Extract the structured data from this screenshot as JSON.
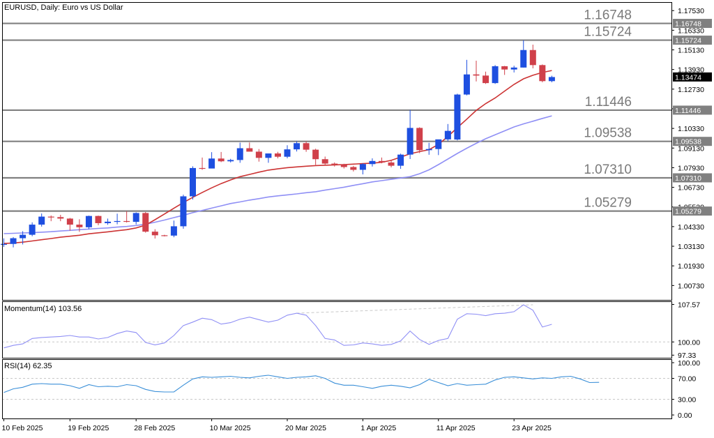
{
  "chart_data": {
    "type": "candlestick",
    "title": "EURUSD, Daily:  Euro vs US Dollar",
    "symbol": "EURUSD",
    "timeframe": "Daily",
    "description": "Euro vs US Dollar",
    "current_price": "1.13474",
    "price_axis": {
      "ticks": [
        "1.17530",
        "1.16330",
        "1.15130",
        "1.13930",
        "1.12730",
        "1.11530",
        "1.10330",
        "1.09130",
        "1.07930",
        "1.06730",
        "1.05530",
        "1.04330",
        "1.03130",
        "1.01930",
        "1.00730"
      ],
      "range": [
        0.9985,
        1.1805
      ]
    },
    "x_axis": {
      "labels": [
        {
          "text": "10 Feb 2025",
          "bar": 0
        },
        {
          "text": "19 Feb 2025",
          "bar": 7
        },
        {
          "text": "28 Feb 2025",
          "bar": 14
        },
        {
          "text": "10 Mar 2025",
          "bar": 22
        },
        {
          "text": "20 Mar 2025",
          "bar": 30
        },
        {
          "text": "1 Apr 2025",
          "bar": 38
        },
        {
          "text": "11 Apr 2025",
          "bar": 46
        },
        {
          "text": "23 Apr 2025",
          "bar": 54
        }
      ]
    },
    "horizontal_levels": [
      {
        "value": 1.16748,
        "label": "1.16748",
        "tag": "1.16748"
      },
      {
        "value": 1.15724,
        "label": "1.15724",
        "tag": "1.15724"
      },
      {
        "value": 1.11446,
        "label": "1.11446",
        "tag": "1.11446"
      },
      {
        "value": 1.09538,
        "label": "1.09538",
        "tag": "1.09538"
      },
      {
        "value": 1.0731,
        "label": "1.07310",
        "tag": "1.07310"
      },
      {
        "value": 1.05279,
        "label": "1.05279",
        "tag": "1.05279"
      }
    ],
    "candles": [
      [
        1.0326,
        1.0361,
        1.0309,
        1.0327
      ],
      [
        1.0327,
        1.0369,
        1.0306,
        1.0362
      ],
      [
        1.0362,
        1.0405,
        1.0324,
        1.0383
      ],
      [
        1.0383,
        1.0459,
        1.0374,
        1.0445
      ],
      [
        1.0445,
        1.0513,
        1.0433,
        1.0494
      ],
      [
        1.0494,
        1.0501,
        1.0466,
        1.0491
      ],
      [
        1.0491,
        1.0505,
        1.0466,
        1.0482
      ],
      [
        1.0482,
        1.0486,
        1.0408,
        1.0445
      ],
      [
        1.0445,
        1.0478,
        1.0401,
        1.0429
      ],
      [
        1.0429,
        1.05,
        1.0418,
        1.0498
      ],
      [
        1.0498,
        1.05,
        1.0441,
        1.0454
      ],
      [
        1.0454,
        1.0482,
        1.0444,
        1.0463
      ],
      [
        1.0463,
        1.0512,
        1.0447,
        1.0467
      ],
      [
        1.0467,
        1.0527,
        1.0458,
        1.0462
      ],
      [
        1.0462,
        1.052,
        1.0446,
        1.0516
      ],
      [
        1.0516,
        1.0522,
        1.0396,
        1.0402
      ],
      [
        1.0402,
        1.0417,
        1.036,
        1.038
      ],
      [
        1.038,
        1.0383,
        1.0373,
        1.0378
      ],
      [
        1.0378,
        1.047,
        1.0368,
        1.0435
      ],
      [
        1.0435,
        1.0628,
        1.042,
        1.0618
      ],
      [
        1.0618,
        1.0801,
        1.0599,
        1.0791
      ],
      [
        1.0791,
        1.0855,
        1.078,
        1.0788
      ],
      [
        1.0788,
        1.0888,
        1.0789,
        1.0849
      ],
      [
        1.0849,
        1.0889,
        1.0827,
        1.0832
      ],
      [
        1.0832,
        1.0847,
        1.0825,
        1.084
      ],
      [
        1.084,
        1.0946,
        1.0823,
        1.0912
      ],
      [
        1.0912,
        1.0947,
        1.0897,
        1.0891
      ],
      [
        1.0891,
        1.0907,
        1.083,
        1.0853
      ],
      [
        1.0853,
        1.088,
        1.0823,
        1.088
      ],
      [
        1.088,
        1.089,
        1.085,
        1.086
      ],
      [
        1.086,
        1.093,
        1.085,
        1.0905
      ],
      [
        1.0905,
        1.0955,
        1.0892,
        1.0943
      ],
      [
        1.0943,
        1.0954,
        1.089,
        1.0903
      ],
      [
        1.0903,
        1.0909,
        1.081,
        1.0845
      ],
      [
        1.0845,
        1.0861,
        1.081,
        1.0818
      ],
      [
        1.0818,
        1.0825,
        1.08,
        1.0813
      ],
      [
        1.0813,
        1.0817,
        1.0788,
        1.0797
      ],
      [
        1.0797,
        1.0804,
        1.077,
        1.078
      ],
      [
        1.078,
        1.082,
        1.0752,
        1.0815
      ],
      [
        1.0815,
        1.085,
        1.08,
        1.0834
      ],
      [
        1.0834,
        1.0855,
        1.082,
        1.0825
      ],
      [
        1.0825,
        1.0838,
        1.0795,
        1.0805
      ],
      [
        1.0805,
        1.0879,
        1.0786,
        1.0873
      ],
      [
        1.0873,
        1.1146,
        1.0846,
        1.1036
      ],
      [
        1.1036,
        1.104,
        1.0882,
        1.09
      ],
      [
        1.09,
        1.0945,
        1.0872,
        1.0907
      ],
      [
        1.0907,
        1.092,
        1.087,
        1.0966
      ],
      [
        1.0966,
        1.106,
        1.0955,
        1.1018
      ],
      [
        1.0965,
        1.1245,
        1.096,
        1.124
      ],
      [
        1.124,
        1.1452,
        1.1235,
        1.1363
      ],
      [
        1.1363,
        1.1447,
        1.132,
        1.1356
      ],
      [
        1.1356,
        1.138,
        1.1305,
        1.131
      ],
      [
        1.131,
        1.142,
        1.1305,
        1.1413
      ],
      [
        1.1413,
        1.1415,
        1.136,
        1.1393
      ],
      [
        1.1393,
        1.1416,
        1.1375,
        1.1405
      ],
      [
        1.1405,
        1.1572,
        1.1405,
        1.1512
      ],
      [
        1.1512,
        1.1545,
        1.14,
        1.142
      ],
      [
        1.142,
        1.1424,
        1.1315,
        1.1322
      ],
      [
        1.1322,
        1.1355,
        1.1315,
        1.1347
      ]
    ],
    "ma_fast": {
      "name": "",
      "color": "#cc3333",
      "values": [
        1.033,
        1.0333,
        1.0338,
        1.0345,
        1.0353,
        1.036,
        1.0368,
        1.0374,
        1.038,
        1.0389,
        1.0395,
        1.0401,
        1.0408,
        1.0414,
        1.0425,
        1.0442,
        1.0475,
        1.051,
        1.0545,
        1.058,
        1.0612,
        1.0642,
        1.067,
        1.0696,
        1.0718,
        1.0738,
        1.0752,
        1.0766,
        1.0778,
        1.0786,
        1.0793,
        1.0798,
        1.0802,
        1.0806,
        1.0808,
        1.081,
        1.0812,
        1.0815,
        1.0818,
        1.0821,
        1.0826,
        1.0838,
        1.0858,
        1.0878,
        1.0891,
        1.0903,
        1.0935,
        1.0984,
        1.1038,
        1.109,
        1.1143,
        1.1185,
        1.1219,
        1.1261,
        1.1302,
        1.1336,
        1.1358,
        1.1375,
        1.1387
      ]
    },
    "ma_slow": {
      "name": "",
      "color": "#8f8ff5",
      "values": [
        1.039,
        1.0392,
        1.0394,
        1.0396,
        1.0399,
        1.0402,
        1.0406,
        1.041,
        1.0414,
        1.0418,
        1.0422,
        1.0425,
        1.043,
        1.0434,
        1.044,
        1.0448,
        1.046,
        1.0473,
        1.0488,
        1.0502,
        1.0518,
        1.0532,
        1.0546,
        1.056,
        1.0574,
        1.0584,
        1.0595,
        1.0604,
        1.0614,
        1.0621,
        1.0627,
        1.0633,
        1.064,
        1.0646,
        1.0656,
        1.0665,
        1.0674,
        1.0685,
        1.0695,
        1.0706,
        1.0714,
        1.0722,
        1.073,
        1.0738,
        1.0756,
        1.078,
        1.0812,
        1.0846,
        1.088,
        1.0912,
        1.0942,
        1.097,
        1.0994,
        1.1018,
        1.1042,
        1.1061,
        1.1077,
        1.1094,
        1.111
      ]
    },
    "momentum": {
      "label": "Momentum(14) 103.56",
      "axis_ticks": [
        "107.57",
        "100.00",
        "97.33"
      ],
      "range": [
        96.8,
        108.2
      ],
      "values": [
        98.8,
        99.3,
        99.6,
        100.7,
        100.9,
        101.0,
        101.1,
        101.3,
        101.0,
        101.0,
        100.6,
        100.9,
        101.7,
        102.2,
        101.9,
        99.9,
        99.4,
        99.8,
        101.3,
        103.3,
        104.0,
        104.8,
        104.5,
        103.6,
        103.9,
        104.6,
        105.0,
        104.5,
        104.0,
        104.4,
        105.4,
        105.8,
        105.4,
        103.3,
        100.7,
        100.4,
        99.3,
        99.4,
        99.8,
        99.6,
        99.3,
        99.5,
        100.2,
        102.2,
        100.5,
        99.5,
        100.3,
        100.7,
        104.6,
        105.7,
        105.6,
        105.3,
        105.7,
        105.8,
        106.1,
        107.5,
        106.4,
        103.0,
        103.56
      ],
      "trendline": {
        "from_bar": 31,
        "from_value": 105.8,
        "to_bar": 56,
        "to_value": 107.5
      }
    },
    "rsi": {
      "label": "RSI(14) 62.35",
      "axis_ticks": [
        "100.00",
        "70.00",
        "30.00",
        "0.00"
      ],
      "range": [
        0,
        100
      ],
      "levels": [
        70,
        30
      ],
      "values": [
        43,
        50,
        53,
        59,
        60,
        59,
        59,
        56,
        51,
        58,
        54,
        55,
        54,
        58,
        56,
        49,
        45,
        44,
        44,
        57,
        69,
        73,
        72,
        73,
        74,
        72,
        71,
        74,
        76,
        73,
        70,
        72,
        73,
        75,
        70,
        61,
        57,
        57,
        54,
        51,
        55,
        57,
        55,
        52,
        58,
        68,
        62,
        56,
        60,
        57,
        58,
        59,
        67,
        72,
        73,
        71,
        69,
        71,
        70,
        73,
        74,
        69,
        62,
        62.35
      ]
    }
  }
}
